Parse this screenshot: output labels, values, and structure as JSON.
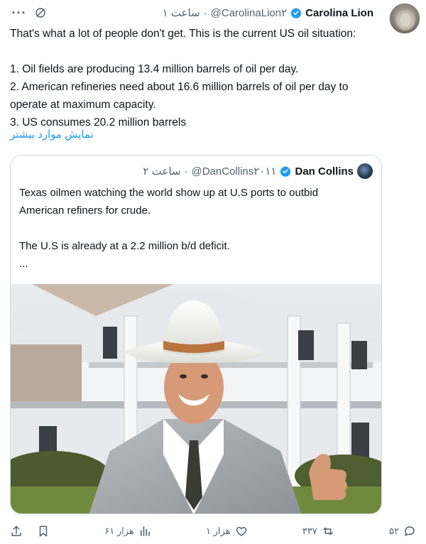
{
  "tweet": {
    "author_name": "Carolina Lion",
    "author_handle": "@CarolinaLion۲",
    "time": "ساعت ۱",
    "separator": "·",
    "more_label": "···",
    "lines": [
      "That's what a lot of people don't get. This is the current US oil situation:",
      "1. Oil fields are producing 13.4 million barrels of oil per day.",
      "2. American refineries need about 16.6 million barrels of oil per day to",
      "operate at maximum capacity.",
      "3. US consumes 20.2 million barrels"
    ],
    "show_more": "نمایش موارد بیشتر"
  },
  "quote": {
    "author_name": "Dan Collins",
    "author_handle": "@DanCollins۲۰۱۱",
    "time": "ساعت ۲",
    "separator": "·",
    "lines": [
      "Texas oilmen watching the world show up at U.S ports to outbid",
      "American refiners for crude.",
      "The U.S is already at a 2.2 million b/d deficit.",
      "..."
    ]
  },
  "actions": {
    "replies": "۵۲",
    "reposts": "۳۳۷",
    "likes": "۱ هزار",
    "views": "۶۱ هزار"
  },
  "colors": {
    "verified": "#1d9bf0",
    "link": "#1d9bf0",
    "muted": "#536471",
    "border": "#cfd9de"
  }
}
